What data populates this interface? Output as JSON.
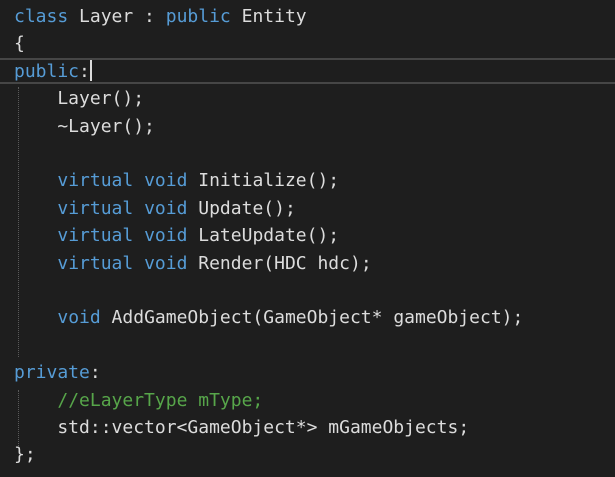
{
  "editor": {
    "language": "C++",
    "cursor": {
      "line": 3
    },
    "lines": [
      {
        "tokens": [
          {
            "t": "class",
            "c": "kw"
          },
          {
            "t": " Layer : ",
            "c": "pl"
          },
          {
            "t": "public",
            "c": "kw"
          },
          {
            "t": " Entity",
            "c": "pl"
          }
        ]
      },
      {
        "tokens": [
          {
            "t": "{",
            "c": "pl"
          }
        ]
      },
      {
        "tokens": [
          {
            "t": "public",
            "c": "kw"
          },
          {
            "t": ":",
            "c": "pl"
          }
        ]
      },
      {
        "tokens": [
          {
            "t": "    Layer();",
            "c": "pl"
          }
        ]
      },
      {
        "tokens": [
          {
            "t": "    ~Layer();",
            "c": "pl"
          }
        ]
      },
      {
        "tokens": []
      },
      {
        "tokens": [
          {
            "t": "    ",
            "c": "pl"
          },
          {
            "t": "virtual",
            "c": "kw"
          },
          {
            "t": " ",
            "c": "pl"
          },
          {
            "t": "void",
            "c": "kw"
          },
          {
            "t": " Initialize();",
            "c": "pl"
          }
        ]
      },
      {
        "tokens": [
          {
            "t": "    ",
            "c": "pl"
          },
          {
            "t": "virtual",
            "c": "kw"
          },
          {
            "t": " ",
            "c": "pl"
          },
          {
            "t": "void",
            "c": "kw"
          },
          {
            "t": " Update();",
            "c": "pl"
          }
        ]
      },
      {
        "tokens": [
          {
            "t": "    ",
            "c": "pl"
          },
          {
            "t": "virtual",
            "c": "kw"
          },
          {
            "t": " ",
            "c": "pl"
          },
          {
            "t": "void",
            "c": "kw"
          },
          {
            "t": " LateUpdate();",
            "c": "pl"
          }
        ]
      },
      {
        "tokens": [
          {
            "t": "    ",
            "c": "pl"
          },
          {
            "t": "virtual",
            "c": "kw"
          },
          {
            "t": " ",
            "c": "pl"
          },
          {
            "t": "void",
            "c": "kw"
          },
          {
            "t": " Render(HDC hdc);",
            "c": "pl"
          }
        ]
      },
      {
        "tokens": []
      },
      {
        "tokens": [
          {
            "t": "    ",
            "c": "pl"
          },
          {
            "t": "void",
            "c": "kw"
          },
          {
            "t": " AddGameObject(GameObject* gameObject);",
            "c": "pl"
          }
        ]
      },
      {
        "tokens": []
      },
      {
        "tokens": [
          {
            "t": "private",
            "c": "kw"
          },
          {
            "t": ":",
            "c": "pl"
          }
        ]
      },
      {
        "tokens": [
          {
            "t": "    ",
            "c": "pl"
          },
          {
            "t": "//eLayerType mType;",
            "c": "cm"
          }
        ]
      },
      {
        "tokens": [
          {
            "t": "    std::vector<GameObject*> mGameObjects;",
            "c": "pl"
          }
        ]
      },
      {
        "tokens": [
          {
            "t": "};",
            "c": "pl"
          }
        ]
      }
    ]
  },
  "colors": {
    "background": "#1e1e1e",
    "keyword": "#569cd6",
    "text": "#dcdcdc",
    "comment": "#57a64a",
    "current_line_border": "#464646"
  }
}
